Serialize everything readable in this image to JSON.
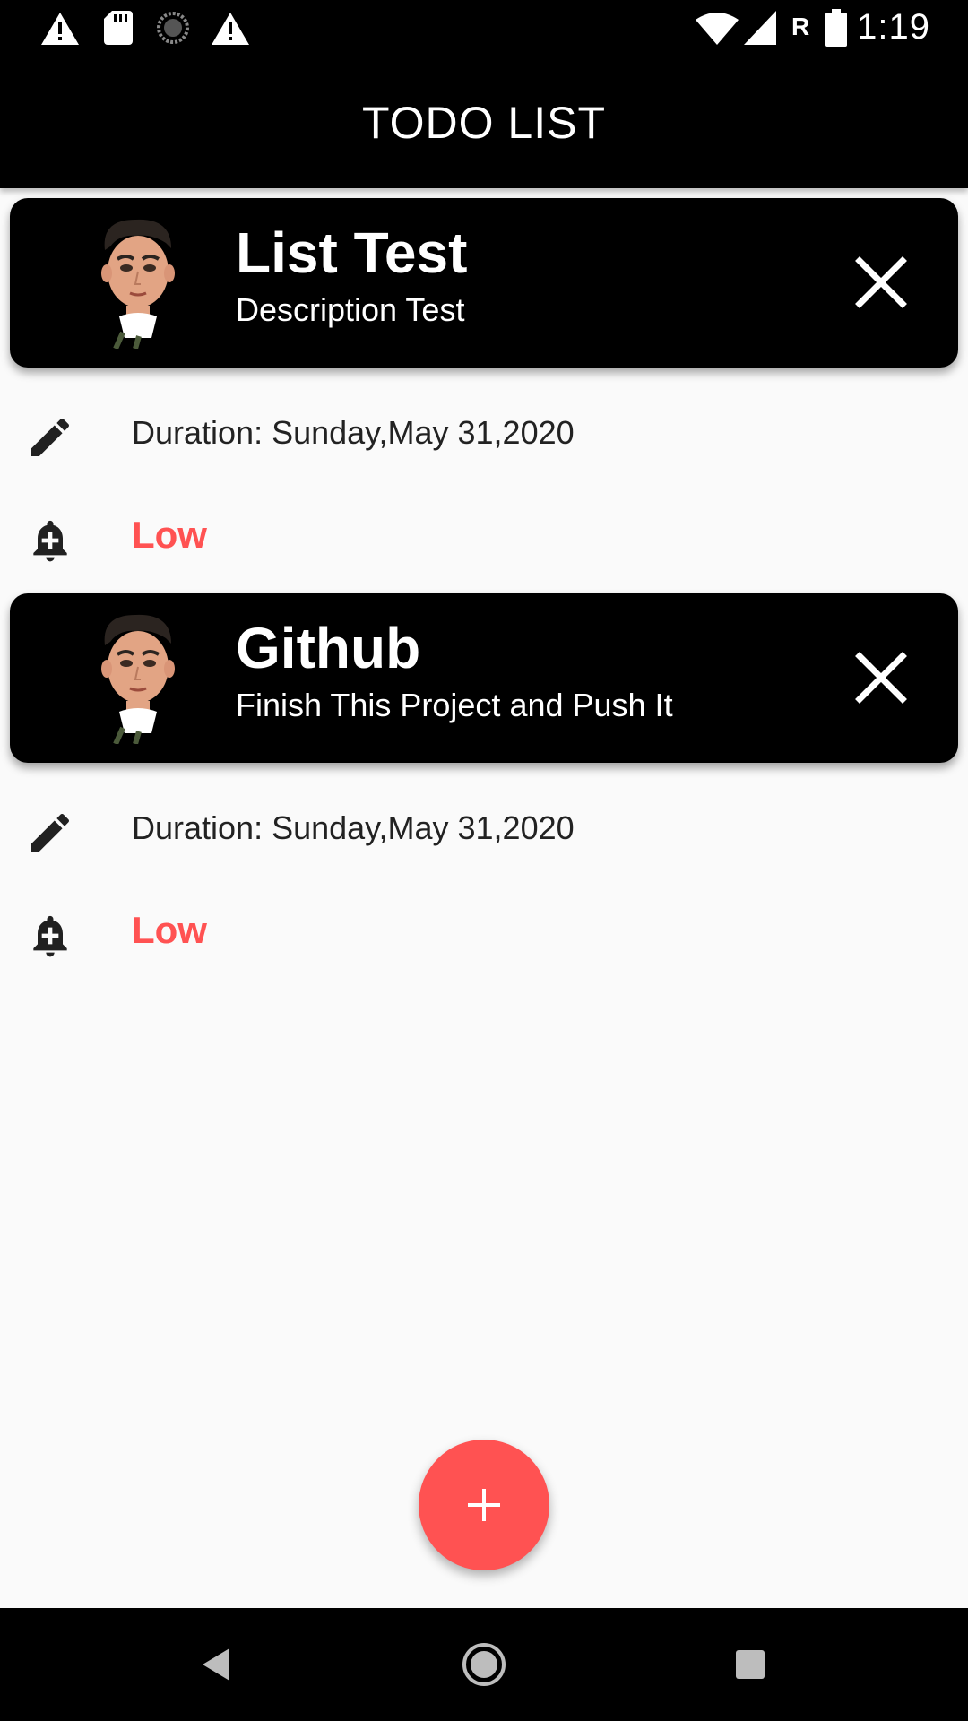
{
  "status_bar": {
    "time": "1:19",
    "left_icons": [
      "warning-icon",
      "sd-card-icon",
      "sync-icon",
      "warning-icon"
    ],
    "right_icons": [
      "wifi-icon",
      "signal-icon",
      "roaming-icon",
      "battery-icon"
    ],
    "roaming_label": "R"
  },
  "app_bar": {
    "title": "TODO LIST"
  },
  "colors": {
    "accent": "#ff5252",
    "card_bg": "#000000",
    "background": "#fafafa"
  },
  "todos": [
    {
      "title": "List Test",
      "description": "Description Test",
      "duration": "Duration: Sunday,May 31,2020",
      "priority": "Low"
    },
    {
      "title": "Github",
      "description": "Finish This Project and Push It",
      "duration": "Duration: Sunday,May 31,2020",
      "priority": "Low"
    }
  ],
  "fab": {
    "icon": "plus-icon"
  },
  "nav_bar": {
    "buttons": [
      "back-icon",
      "home-icon",
      "recents-icon"
    ]
  }
}
